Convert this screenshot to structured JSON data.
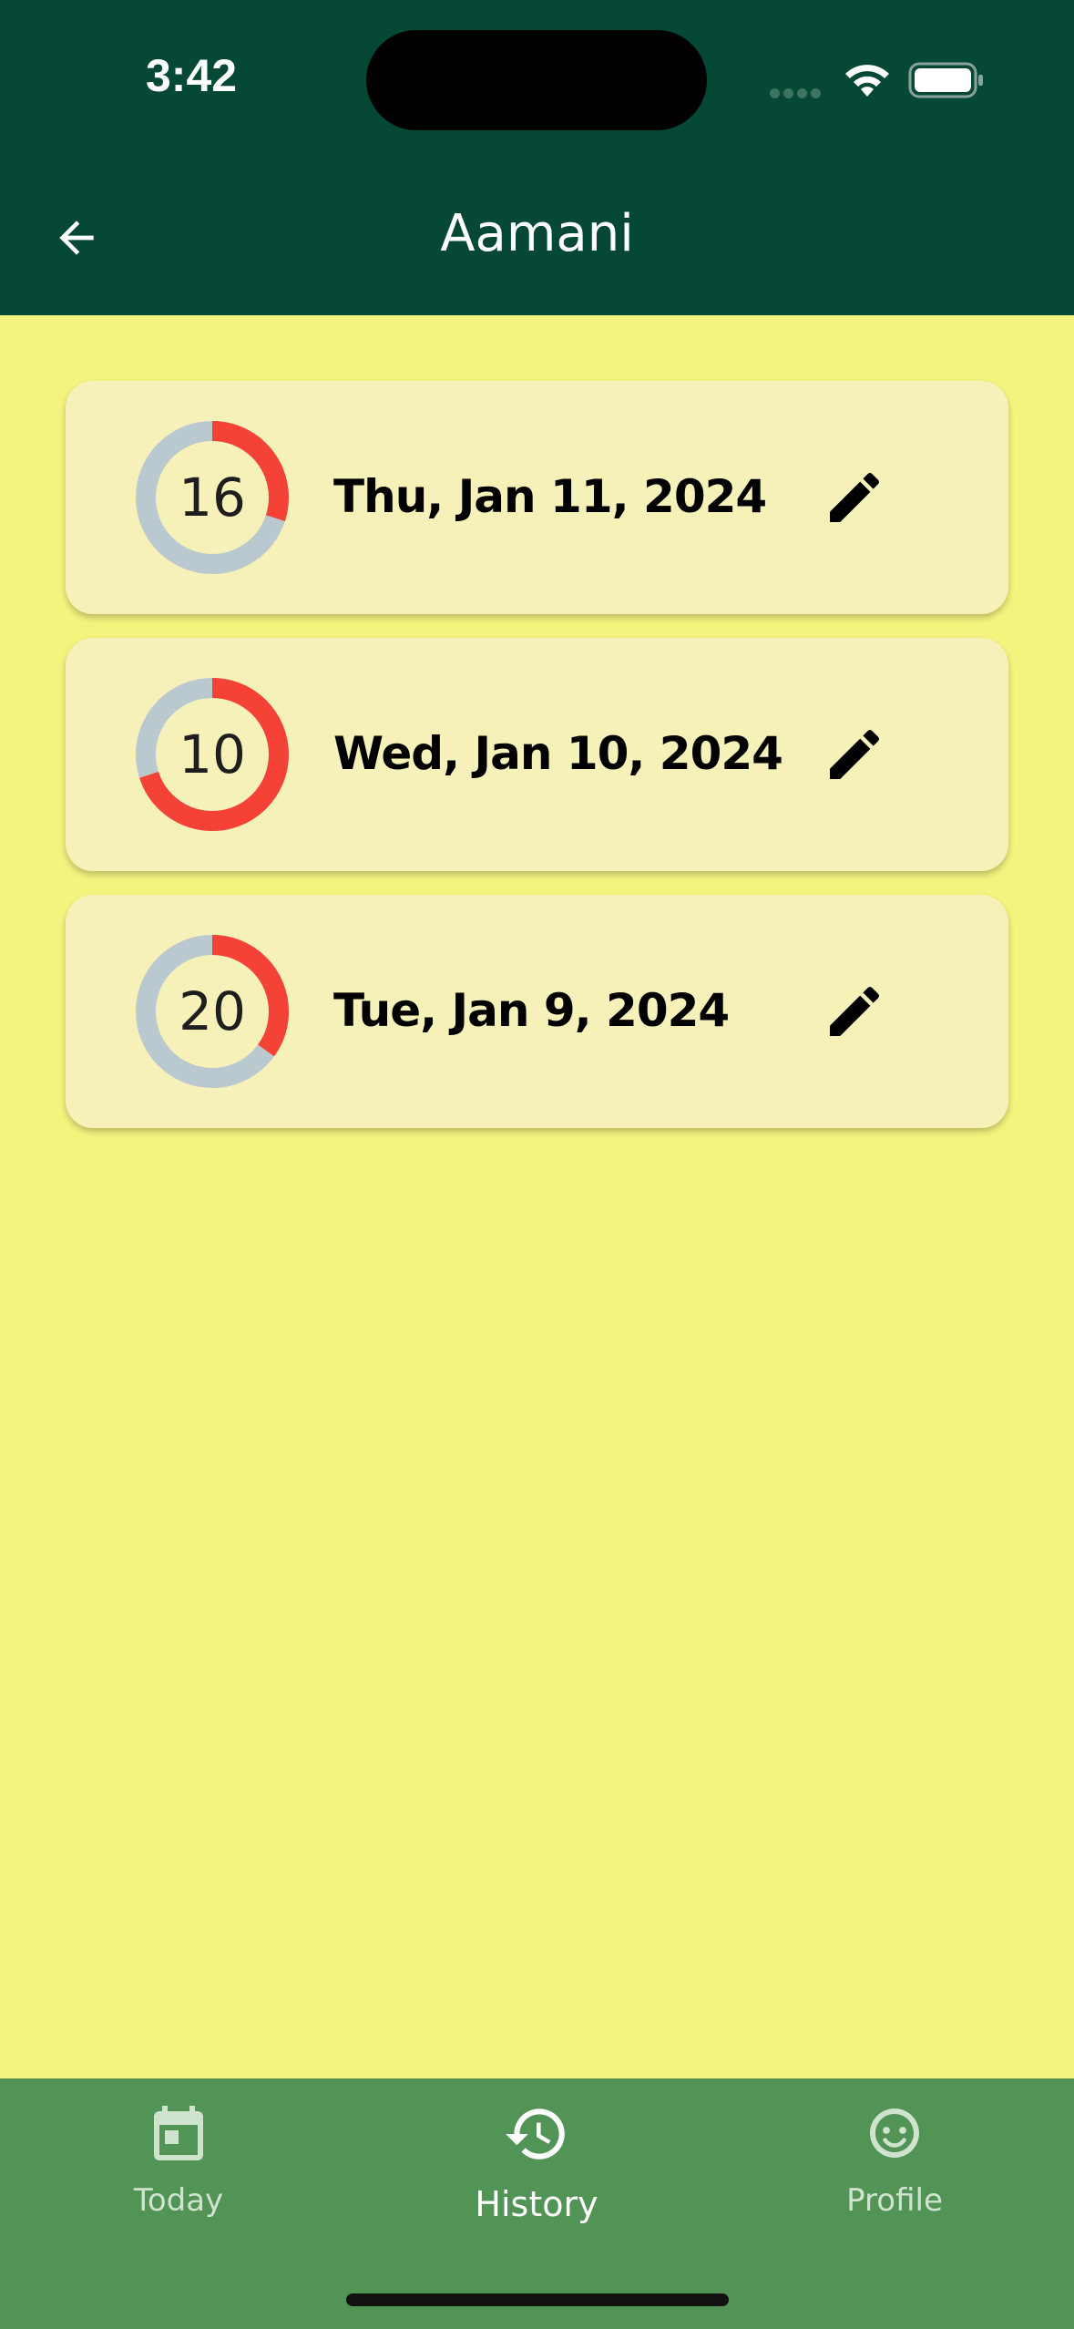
{
  "status_bar": {
    "time": "3:42"
  },
  "header": {
    "title": "Aamani"
  },
  "history": [
    {
      "count": "16",
      "date": "Thu, Jan 11, 2024",
      "fraction": 0.3
    },
    {
      "count": "10",
      "date": "Wed, Jan 10, 2024",
      "fraction": 0.7
    },
    {
      "count": "20",
      "date": "Tue, Jan 9, 2024",
      "fraction": 0.35
    }
  ],
  "tabs": [
    {
      "label": "Today",
      "icon": "calendar-icon",
      "active": false
    },
    {
      "label": "History",
      "icon": "history-icon",
      "active": true
    },
    {
      "label": "Profile",
      "icon": "face-icon",
      "active": false
    }
  ],
  "colors": {
    "header": "#054835",
    "background": "#f3f37e",
    "card": "#f6f0b9",
    "ring_track": "#bac9d0",
    "ring_progress": "#f44336",
    "tabbar": "#529356"
  }
}
